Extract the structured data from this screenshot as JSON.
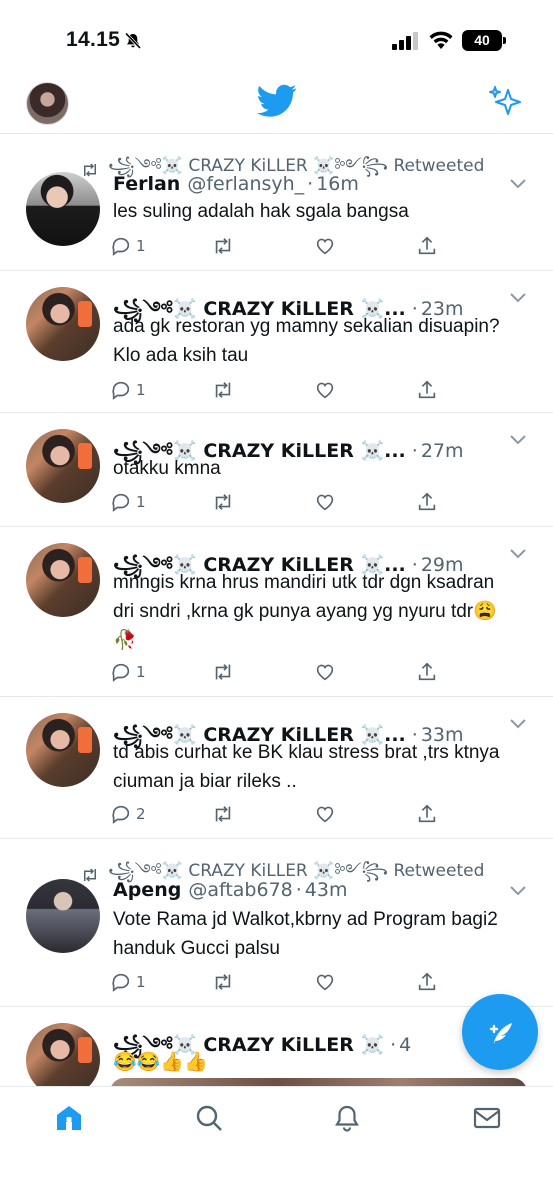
{
  "status": {
    "time": "14.15",
    "battery": "40"
  },
  "topnav": {
    "avatar": "profile-avatar",
    "logo": "bird-icon",
    "sparkle": "sparkle-icon"
  },
  "accent": "#1d9bf0",
  "tweets": [
    {
      "retweeted_by": "꧁༺☠️ CRAZY KiLLER ☠️༻꧂ Retweeted",
      "name": "Ferlan",
      "handle": "@ferlansyh_",
      "time": "16m",
      "text": "les suling adalah hak sgala bangsa",
      "replies": "1"
    },
    {
      "name": "꧁༺☠️ CRAZY KiLLER ☠️...",
      "time": "23m",
      "text": "ada gk restoran yg mamny sekalian disuapin? Klo ada ksih tau",
      "replies": "1"
    },
    {
      "name": "꧁༺☠️ CRAZY KiLLER ☠️...",
      "time": "27m",
      "text": "otakku kmna",
      "replies": "1"
    },
    {
      "name": "꧁༺☠️ CRAZY KiLLER ☠️...",
      "time": "29m",
      "text": "mnngis krna hrus mandiri utk tdr dgn ksadran dri sndri ,krna gk punya ayang yg nyuru tdr😩 🥀",
      "replies": "1"
    },
    {
      "name": "꧁༺☠️ CRAZY KiLLER ☠️...",
      "time": "33m",
      "text": "td abis curhat ke BK klau stress brat ,trs ktnya ciuman ja biar rileks ..",
      "replies": "2"
    },
    {
      "retweeted_by": "꧁༺☠️ CRAZY KiLLER ☠️༻꧂ Retweeted",
      "name": "Apeng",
      "handle": "@aftab678",
      "time": "43m",
      "text": "Vote Rama jd Walkot,kbrny ad Program bagi2 handuk Gucci palsu",
      "replies": "1"
    },
    {
      "name": "꧁༺☠️ CRAZY KiLLER ☠️",
      "time": "4",
      "text": "😂😂👍👍"
    }
  ],
  "tabs": [
    "home-icon",
    "search-icon",
    "notifications-icon",
    "messages-icon"
  ]
}
